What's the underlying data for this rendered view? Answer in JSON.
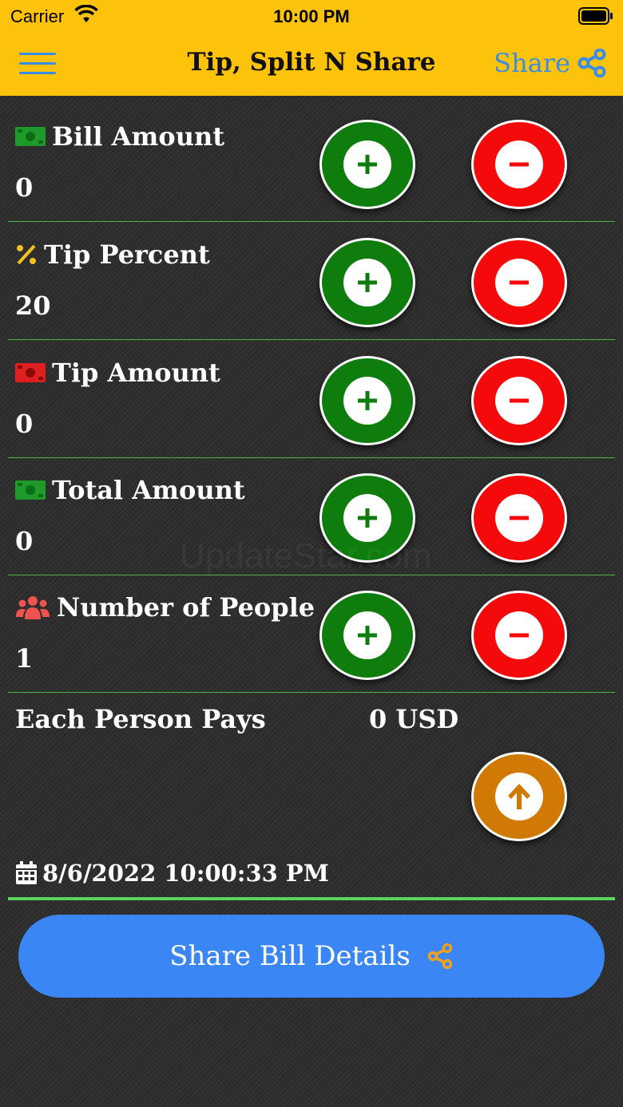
{
  "status_bar": {
    "carrier": "Carrier",
    "time": "10:00 PM"
  },
  "nav": {
    "title": "Tip, Split N Share",
    "share_label": "Share"
  },
  "rows": [
    {
      "label": "Bill Amount",
      "value": "0",
      "icon": "money-icon"
    },
    {
      "label": "Tip Percent",
      "value": "20",
      "icon": "percent-icon"
    },
    {
      "label": "Tip Amount",
      "value": "0",
      "icon": "money-red-icon"
    },
    {
      "label": "Total Amount",
      "value": "0",
      "icon": "money-icon"
    },
    {
      "label": "Number of People",
      "value": "1",
      "icon": "people-icon"
    }
  ],
  "summary": {
    "label": "Each Person Pays",
    "value": "0 USD"
  },
  "timestamp": "8/6/2022 10:00:33 PM",
  "share_button": "Share Bill Details",
  "watermark": "UpdateStar.com",
  "colors": {
    "header": "#fcc30a",
    "plus": "#0e7d0e",
    "minus": "#f40a0a",
    "up": "#d07a05",
    "share": "#3b86f5",
    "accent_blue": "#3b8be8"
  }
}
